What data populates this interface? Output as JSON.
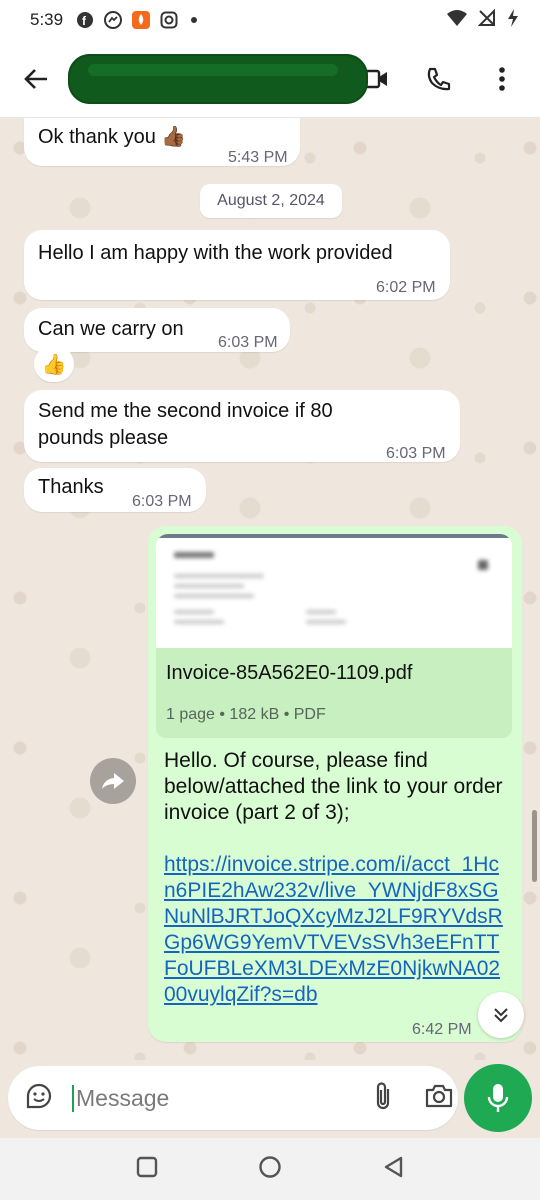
{
  "status_bar": {
    "time": "5:39",
    "icons": [
      "facebook-icon",
      "messenger-icon",
      "app-notification-icon",
      "instagram-icon",
      "dot-icon"
    ],
    "right_icons": [
      "wifi-icon",
      "no-signal-icon",
      "battery-charging-icon"
    ]
  },
  "header": {
    "contact_name": "",
    "actions": [
      "video-call-icon",
      "phone-icon",
      "more-options-icon"
    ]
  },
  "chat": {
    "messages": [
      {
        "dir": "in",
        "text": "Ok thank you 👍🏾",
        "time": "5:43 PM"
      },
      {
        "dir": "in",
        "text": "Hello I am happy with the work provided",
        "time": "6:02 PM"
      },
      {
        "dir": "in",
        "text": "Can we carry on",
        "time": "6:03 PM",
        "reaction": "👍"
      },
      {
        "dir": "in",
        "text": "Send me the second invoice if 80 pounds please",
        "time": "6:03 PM"
      },
      {
        "dir": "in",
        "text": "Thanks",
        "time": "6:03 PM"
      }
    ],
    "date_chip": "August 2, 2024",
    "outgoing": {
      "doc_name": "Invoice-85A562E0-1109.pdf",
      "doc_info": "1 page • 182 kB • PDF",
      "text": "Hello. Of course, please find below/attached the link to your order invoice (part 2 of 3);",
      "link": "https://invoice.stripe.com/i/acct_1Hcn6PIE2hAw232v/live_YWNjdF8xSGNuNlBJRTJoQXcyMzJ2LF9RYVdsRGp6WG9YemVTVEVsSVh3eEFnTTFoUFBLeXM3LDExMzE0NjkwNA0200vuylqZif?s=db",
      "time": "6:42 PM"
    }
  },
  "composer": {
    "placeholder": "Message"
  },
  "colors": {
    "accent_green": "#1ea952",
    "outgoing_bubble": "#d9fdd3",
    "chat_background": "#efe7de",
    "link": "#1565c0"
  }
}
